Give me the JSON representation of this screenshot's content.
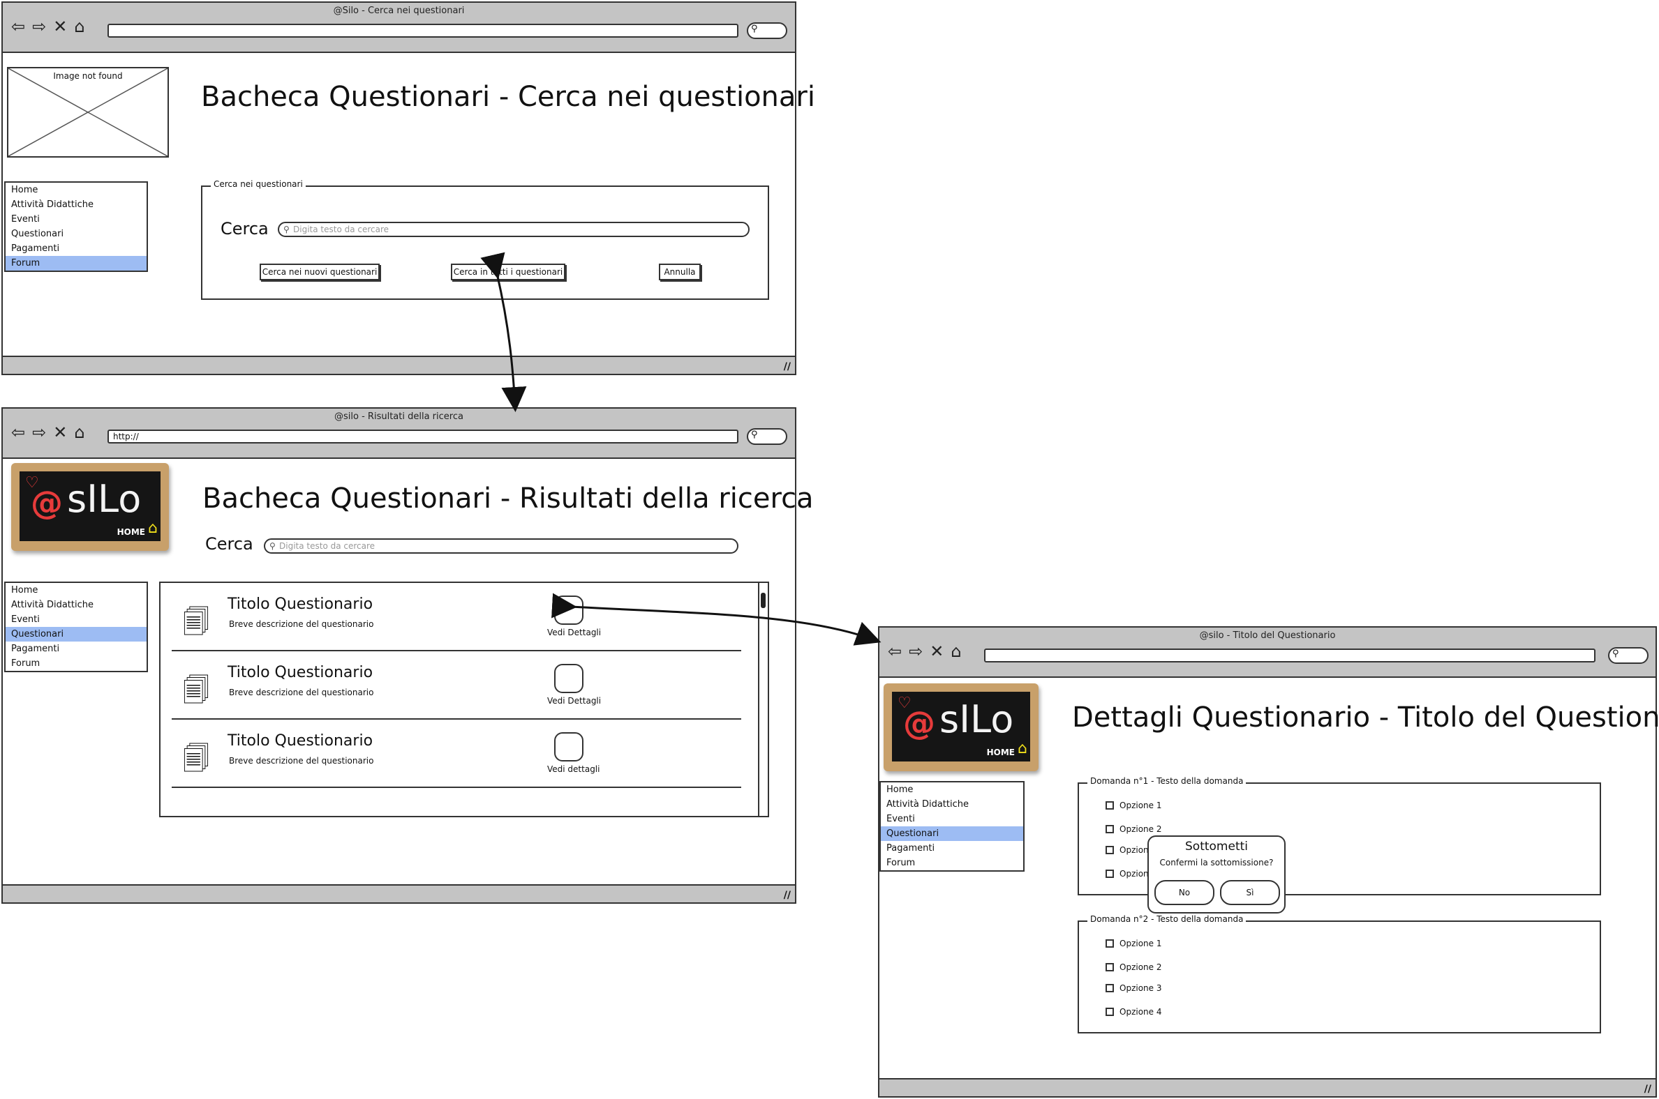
{
  "nav_glyphs": {
    "back": "⇦",
    "forward": "⇨",
    "stop": "✕",
    "home": "⌂",
    "search": "⚲"
  },
  "win1": {
    "title": "@Silo - Cerca nei questionari",
    "url": "",
    "placeholder_image_text": "Image not found",
    "heading": "Bacheca Questionari - Cerca nei questionari",
    "menu": [
      "Home",
      "Attività Didattiche",
      "Eventi",
      "Questionari",
      "Pagamenti",
      "Forum"
    ],
    "menu_selected": "Forum",
    "fieldset_legend": "Cerca nei questionari",
    "search_label": "Cerca",
    "search_placeholder": "Digita testo da cercare",
    "buttons": [
      "Cerca nei nuovi questionari",
      "Cerca in tutti i questionari",
      "Annulla"
    ]
  },
  "win2": {
    "title": "@silo - Risultati della ricerca",
    "url": "http://",
    "heading": "Bacheca Questionari - Risultati della ricerca",
    "search_label": "Cerca",
    "search_placeholder": "Digita testo da cercare",
    "menu": [
      "Home",
      "Attività Didattiche",
      "Eventi",
      "Questionari",
      "Pagamenti",
      "Forum"
    ],
    "menu_selected": "Questionari",
    "results": [
      {
        "title": "Titolo Questionario",
        "desc": "Breve descrizione del questionario",
        "action": "Vedi Dettagli"
      },
      {
        "title": "Titolo Questionario",
        "desc": "Breve descrizione del questionario",
        "action": "Vedi Dettagli"
      },
      {
        "title": "Titolo Questionario",
        "desc": "Breve descrizione del questionario",
        "action": "Vedi dettagli"
      }
    ]
  },
  "win3": {
    "title": "@silo - Titolo del Questionario",
    "url": "",
    "heading": "Dettagli Questionario - Titolo del Questionario",
    "menu": [
      "Home",
      "Attività Didattiche",
      "Eventi",
      "Questionari",
      "Pagamenti",
      "Forum"
    ],
    "menu_selected": "Questionari",
    "q1": {
      "legend": "Domanda n°1 - Testo della domanda",
      "options": [
        "Opzione 1",
        "Opzione 2",
        "Opzion",
        "Opzion"
      ]
    },
    "q2": {
      "legend": "Domanda n°2 - Testo della domanda",
      "options": [
        "Opzione 1",
        "Opzione 2",
        "Opzione 3",
        "Opzione 4"
      ]
    },
    "dialog": {
      "title": "Sottometti",
      "message": "Confermi la sottomissione?",
      "no": "No",
      "yes": "Sì"
    }
  },
  "logo": {
    "at": "@",
    "letters": "sILo",
    "home": "HOME",
    "heart": "♡",
    "house": "⌂"
  },
  "doc_icon": "🗐",
  "colors": {
    "chrome": "#c4c4c4",
    "selection": "#9dbcf3",
    "logo_frame": "#c8a06a",
    "logo_accent": "#e63b3b"
  }
}
